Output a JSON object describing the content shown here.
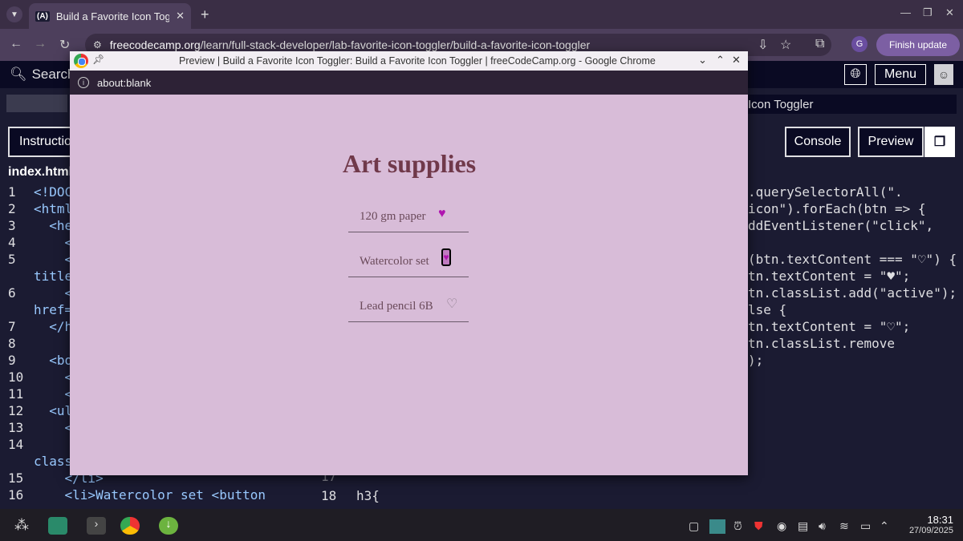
{
  "browser": {
    "tab_title": "Build a Favorite Icon Toggle",
    "tab_favicon": "(A)",
    "url_host": "freecodecamp.org",
    "url_path": "/learn/full-stack-developer/lab-favorite-icon-toggler/build-a-favorite-icon-toggler",
    "profile_initial": "G",
    "finish_update": "Finish update"
  },
  "fcc": {
    "search_label": "Search",
    "menu_label": "Menu",
    "breadcrumb": "Icon Toggler",
    "instructions_label": "Instructions",
    "console_label": "Console",
    "preview_label": "Preview",
    "file_name": "index.html"
  },
  "editor": {
    "lines": [
      {
        "n": "1",
        "code": "<!DOC"
      },
      {
        "n": "2",
        "code": "<html"
      },
      {
        "n": "3",
        "code": "  <he"
      },
      {
        "n": "4",
        "code": "    <"
      },
      {
        "n": "5",
        "code": "    <"
      },
      {
        "n": "",
        "code": "title"
      },
      {
        "n": "6",
        "code": "    <"
      },
      {
        "n": "",
        "code": "href="
      },
      {
        "n": "7",
        "code": "  </h"
      },
      {
        "n": "8",
        "code": ""
      },
      {
        "n": "9",
        "code": "  <bo"
      },
      {
        "n": "10",
        "code": "    <"
      },
      {
        "n": "11",
        "code": "    <"
      },
      {
        "n": "12",
        "code": "  <ul"
      },
      {
        "n": "13",
        "code": "    <"
      },
      {
        "n": "14",
        "code": ""
      },
      {
        "n": "",
        "code": "class"
      },
      {
        "n": "15",
        "code": "    </li>"
      },
      {
        "n": "16",
        "code": "    <li>Watercolor set <button"
      }
    ],
    "css_line_numbers": [
      "17",
      "18"
    ],
    "css_line": "h3{",
    "js_lines": [
      ".querySelectorAll(\".",
      "icon\").forEach(btn => {",
      "ddEventListener(\"click\",",
      "",
      "(btn.textContent === \"♡\") {",
      "tn.textContent = \"♥\";",
      "tn.classList.add(\"active\");",
      "lse {",
      "tn.textContent = \"♡\";",
      "tn.classList.remove",
      ");"
    ]
  },
  "popup": {
    "title": "Preview | Build a Favorite Icon Toggler: Build a Favorite Icon Toggler | freeCodeCamp.org - Google Chrome",
    "address": "about:blank"
  },
  "preview": {
    "heading": "Art supplies",
    "items": [
      {
        "label": "120 gm paper",
        "icon": "♥",
        "active": true
      },
      {
        "label": "Watercolor set",
        "icon": "♥",
        "active": true
      },
      {
        "label": "Lead pencil 6B",
        "icon": "♡",
        "active": false
      }
    ]
  },
  "taskbar": {
    "time": "18:31",
    "date": "27/09/2025"
  },
  "colors": {
    "preview_bg": "#d8bcd8",
    "heading": "#70394a",
    "active_heart": "#b015b0"
  }
}
